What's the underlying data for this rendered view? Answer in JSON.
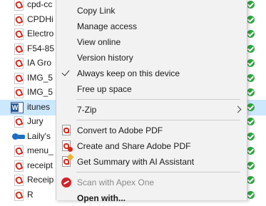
{
  "files": [
    {
      "name": "cpd-cc",
      "type": "pdf",
      "status": "synced"
    },
    {
      "name": "CPDHi",
      "type": "pdf",
      "status": "synced"
    },
    {
      "name": "Electro",
      "type": "pdf",
      "status": "synced"
    },
    {
      "name": "F54-85",
      "type": "pdf",
      "status": "synced"
    },
    {
      "name": "IA Gro",
      "type": "pdf",
      "status": "synced"
    },
    {
      "name": "IMG_5",
      "type": "pdf",
      "status": "synced"
    },
    {
      "name": "IMG_5",
      "type": "pdf",
      "status": "synced"
    },
    {
      "name": "itunes",
      "type": "word",
      "status": "synced",
      "selected": true
    },
    {
      "name": "Jury",
      "type": "pdf",
      "status": "synced"
    },
    {
      "name": "Laily's",
      "type": "app",
      "status": "synced"
    },
    {
      "name": "menu_",
      "type": "pdf",
      "status": "synced"
    },
    {
      "name": "receipt",
      "type": "pdf",
      "status": "synced"
    },
    {
      "name": "Receip",
      "type": "pdf",
      "status": "synced"
    },
    {
      "name": "R",
      "type": "pdf",
      "status": "synced"
    }
  ],
  "menu": {
    "copy_link": "Copy Link",
    "manage_access": "Manage access",
    "view_online": "View online",
    "version_history": "Version history",
    "always_keep": "Always keep on this device",
    "free_up_space": "Free up space",
    "seven_zip": "7-Zip",
    "convert_pdf": "Convert to Adobe PDF",
    "create_share_pdf": "Create and Share Adobe PDF",
    "ai_summary": "Get Summary with AI Assistant",
    "scan_apex": "Scan with Apex One",
    "open_with": "Open with..."
  }
}
